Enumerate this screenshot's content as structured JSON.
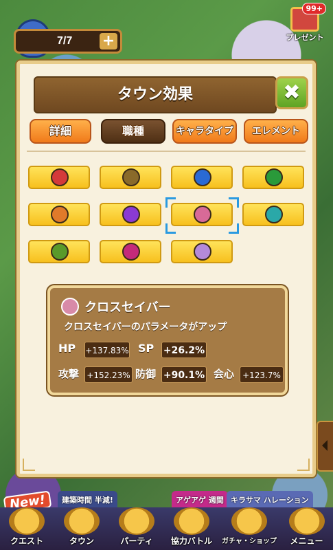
{
  "header": {
    "stamina": "7/7",
    "plus": "+",
    "present_badge": "99+",
    "present_label": "プレゼント"
  },
  "panel": {
    "title": "タウン効果",
    "close": "✖",
    "tabs": [
      {
        "label": "詳細",
        "state": "inactive"
      },
      {
        "label": "職種",
        "state": "selected"
      },
      {
        "label": "キャラタイプ",
        "state": "inactive"
      },
      {
        "label": "エレメント",
        "state": "inactive"
      }
    ]
  },
  "jobs": [
    {
      "icon": "red-sword-icon",
      "color": "#d43a3a"
    },
    {
      "icon": "brown-hammer-icon",
      "color": "#8a6a2a"
    },
    {
      "icon": "blue-axe-icon",
      "color": "#2a6ad4"
    },
    {
      "icon": "green-spear-icon",
      "color": "#2a9a3a"
    },
    {
      "icon": "orange-bow-icon",
      "color": "#e07a2a"
    },
    {
      "icon": "purple-staff-icon",
      "color": "#8a3ad4"
    },
    {
      "icon": "pink-crosssaber-icon",
      "color": "#d86a98",
      "selected": true
    },
    {
      "icon": "teal-star-icon",
      "color": "#2aa8a8"
    },
    {
      "icon": "green-claw-icon",
      "color": "#5a9a2a"
    },
    {
      "icon": "magenta-gun-icon",
      "color": "#c42a7a"
    },
    {
      "icon": "purple-book-icon",
      "color": "#b48ad8"
    }
  ],
  "info": {
    "job_name": "クロスセイバー",
    "description": "クロスセイバーのパラメータがアップ",
    "stats": [
      {
        "label": "HP",
        "value": "+137.83%"
      },
      {
        "label": "SP",
        "value": "+26.2%"
      },
      {
        "label": "攻撃",
        "value": "+152.23%"
      },
      {
        "label": "防御",
        "value": "+90.1%"
      },
      {
        "label": "会心",
        "value": "+123.7%"
      }
    ]
  },
  "promos": {
    "new": "New!",
    "time_half": "建築時間 半減!",
    "ageage": "アゲアゲ 週間",
    "kirasama": "キラサマ ハレーション"
  },
  "bottom_nav": [
    {
      "label": "クエスト"
    },
    {
      "label": "タウン"
    },
    {
      "label": "パーティ"
    },
    {
      "label": "協力バトル"
    },
    {
      "label": "ガチャ・ショップ"
    },
    {
      "label": "メニュー"
    }
  ]
}
